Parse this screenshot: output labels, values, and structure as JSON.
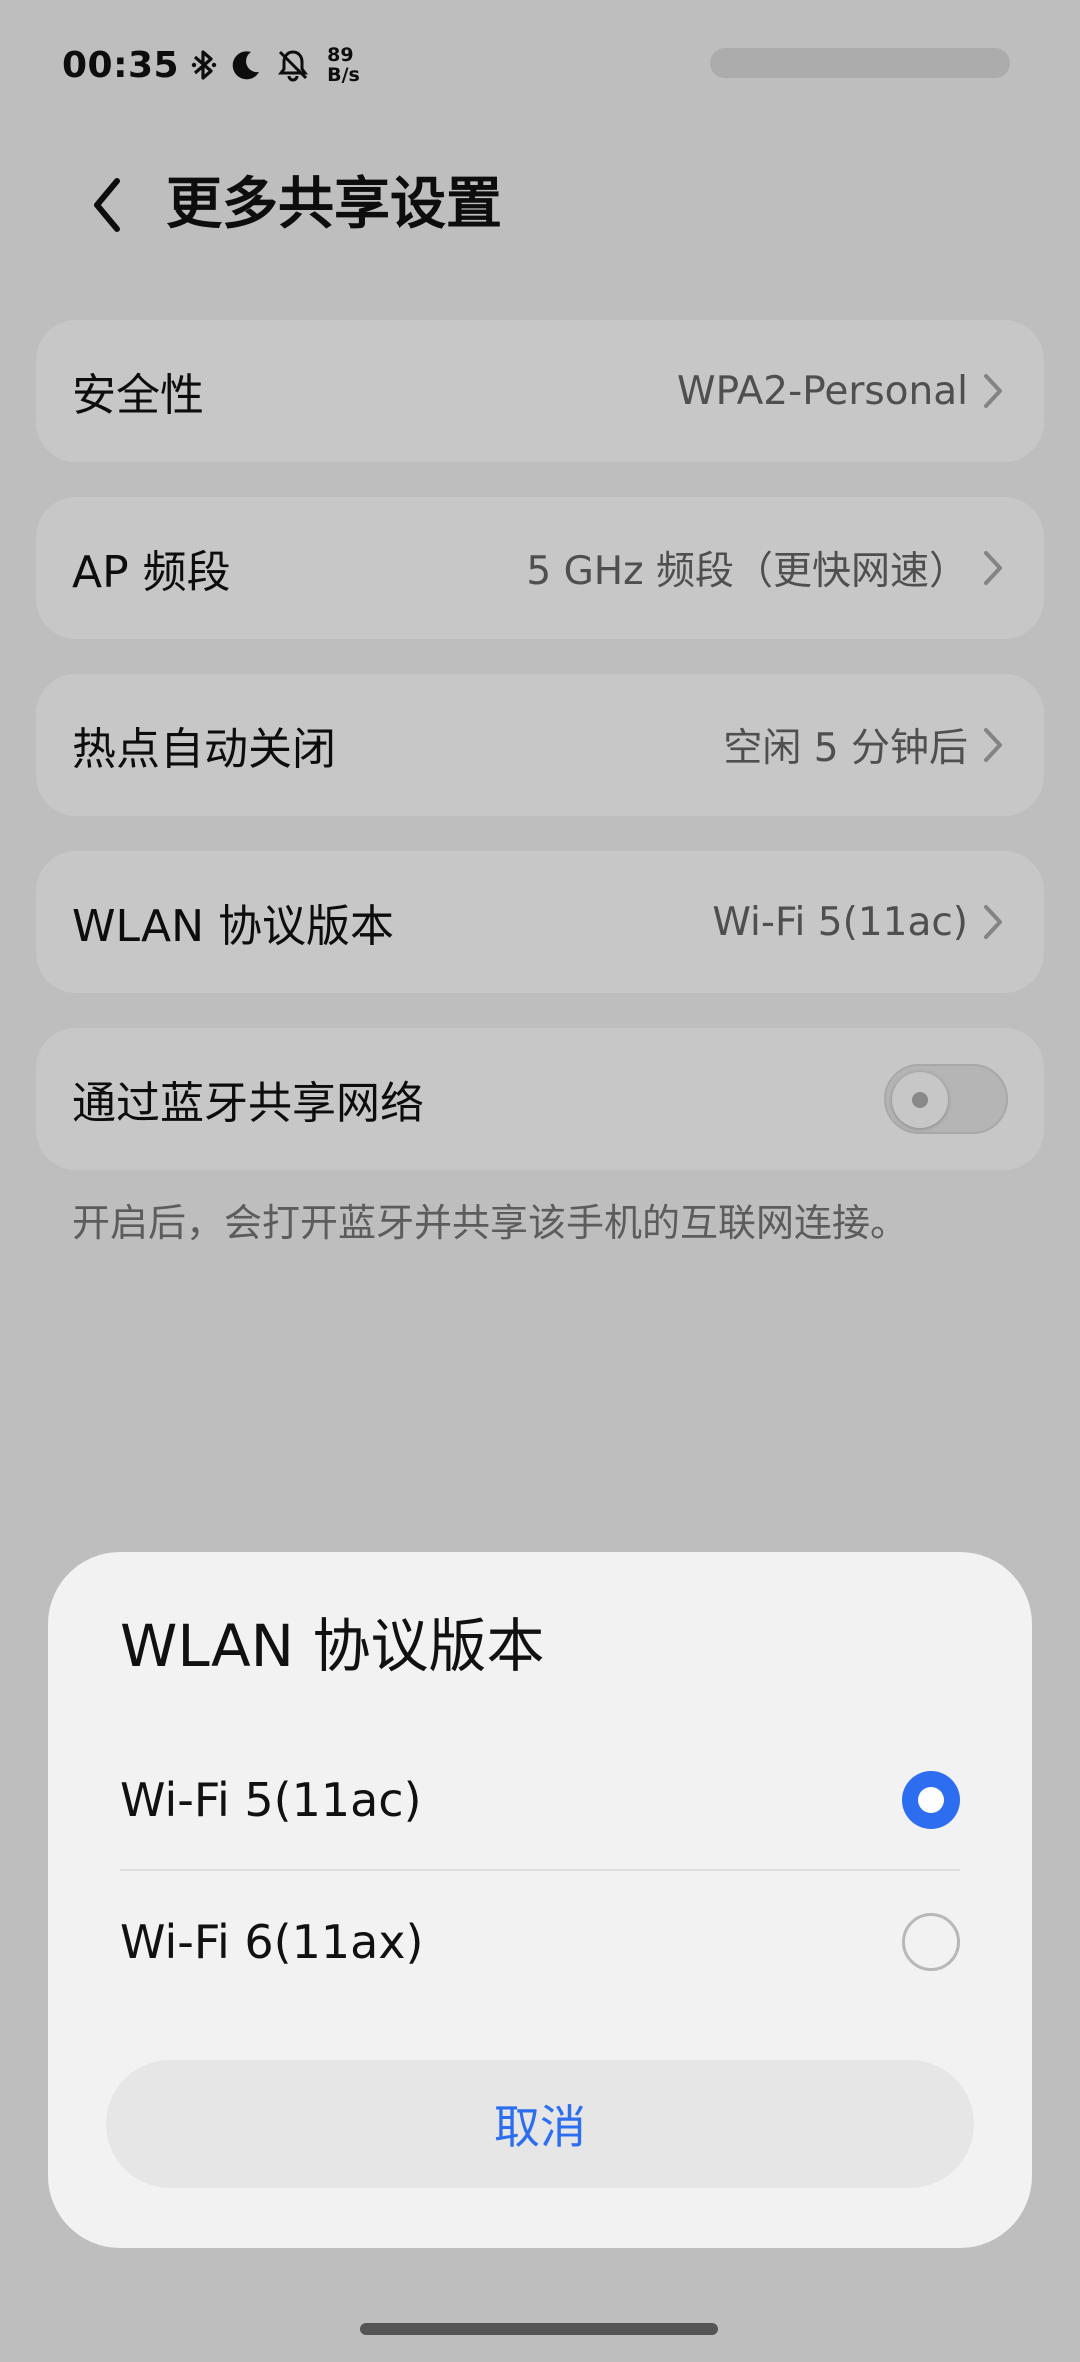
{
  "status_bar": {
    "time": "00:35",
    "icons": [
      "bluetooth-icon",
      "moon-icon",
      "bell-off-icon"
    ],
    "net_speed_value": "89",
    "net_speed_unit": "B/s"
  },
  "header": {
    "title": "更多共享设置"
  },
  "settings": [
    {
      "label": "安全性",
      "value": "WPA2-Personal"
    },
    {
      "label": "AP 频段",
      "value": "5 GHz 频段（更快网速）"
    },
    {
      "label": "热点自动关闭",
      "value": "空闲 5 分钟后"
    },
    {
      "label": "WLAN 协议版本",
      "value": "Wi-Fi 5(11ac)"
    }
  ],
  "bluetooth_share": {
    "label": "通过蓝牙共享网络",
    "enabled": false,
    "hint": "开启后，会打开蓝牙并共享该手机的互联网连接。"
  },
  "dialog": {
    "title": "WLAN 协议版本",
    "options": [
      {
        "label": "Wi-Fi 5(11ac)",
        "selected": true
      },
      {
        "label": "Wi-Fi 6(11ax)",
        "selected": false
      }
    ],
    "cancel_label": "取消"
  },
  "colors": {
    "accent": "#2d6ef0",
    "background": "#f4f4f4",
    "card": "#ffffff",
    "dialog": "#f2f2f2"
  }
}
